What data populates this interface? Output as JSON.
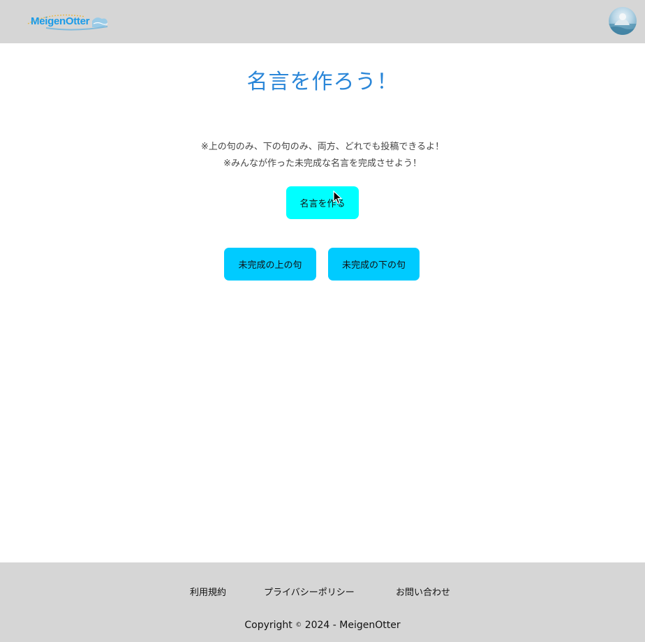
{
  "header": {
    "logo_text": "MeigenOtter",
    "avatar_icon": "user-avatar"
  },
  "main": {
    "title": "名言を作ろう！",
    "notes": [
      "※上の句のみ、下の句のみ、両方、どれでも投稿できるよ！",
      "※みんなが作った未完成な名言を完成させよう！"
    ],
    "create_button": "名言を作る",
    "incomplete_upper_button": "未完成の上の句",
    "incomplete_lower_button": "未完成の下の句"
  },
  "footer": {
    "links": [
      "利用規約",
      "プライバシーポリシー",
      "お問い合わせ"
    ],
    "copyright_symbol": "©",
    "copyright_text": "2024 - MeigenOtter",
    "copyright_prefix": "Copyright"
  },
  "colors": {
    "header_bg": "#d6d6d6",
    "title": "#2a86d8",
    "primary_button": "#00ffff",
    "secondary_button": "#00cbff",
    "logo": "#1a9be8"
  }
}
